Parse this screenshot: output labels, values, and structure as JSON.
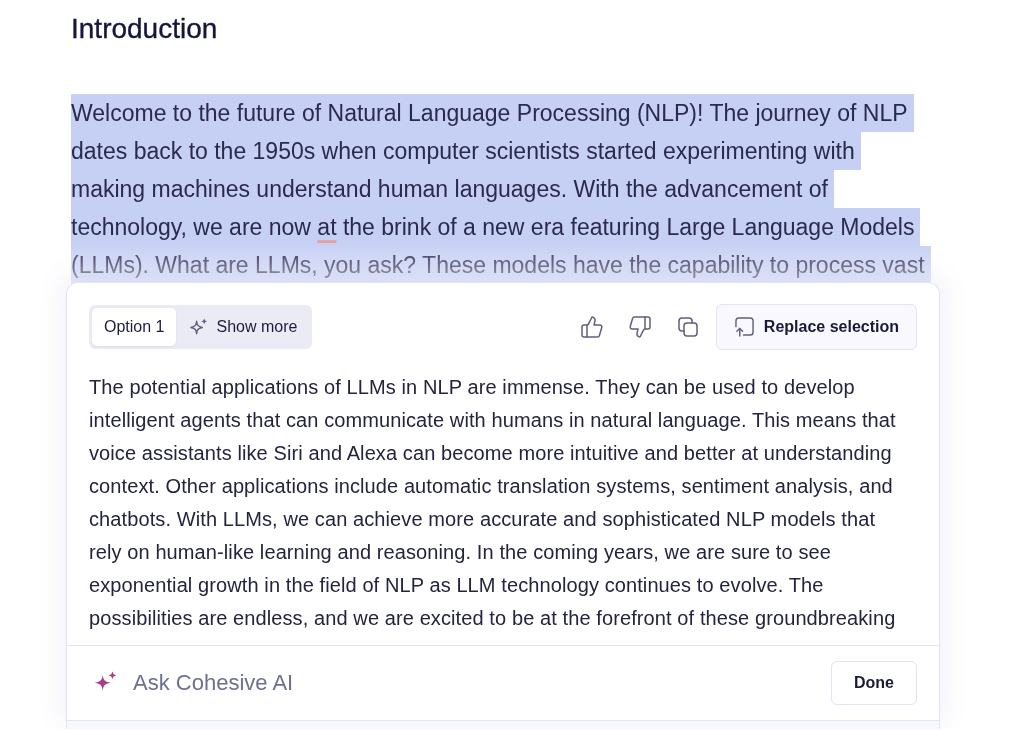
{
  "document": {
    "heading": "Introduction",
    "paragraph": {
      "selected": true,
      "lines": [
        [
          {
            "text": "Welcome to the future of Natural Language Processing (NLP)! The journey of NLP",
            "misspelled": false
          }
        ],
        [
          {
            "text": "dates back to the 1950s when computer scientists started experimenting with",
            "misspelled": false
          }
        ],
        [
          {
            "text": "making machines understand human languages. With the advancement of",
            "misspelled": false
          }
        ],
        [
          {
            "text": "technology, we are now ",
            "misspelled": false
          },
          {
            "text": "at",
            "misspelled": true
          },
          {
            "text": " the brink of a new era featuring Large Language Models",
            "misspelled": false
          }
        ],
        [
          {
            "text": "(LLMs). What are LLMs, you ask? These models have the capability to process vast",
            "misspelled": false
          }
        ]
      ]
    }
  },
  "suggestion_panel": {
    "options": [
      {
        "label": "Option 1",
        "selected": true
      }
    ],
    "show_more": "Show more",
    "replace_button": "Replace selection",
    "text_lines": [
      "The potential applications of LLMs in NLP are immense. They can be used to develop",
      "intelligent agents that can communicate with humans in natural language. This means that",
      "voice assistants like Siri and Alexa can become more intuitive and better at understanding",
      "context. Other applications include automatic translation systems, sentiment analysis, and",
      "chatbots. With LLMs, we can achieve more accurate and sophisticated NLP models that",
      "rely on human-like learning and reasoning. In the coming years, we are sure to see",
      "exponential growth in the field of NLP as LLM technology continues to evolve. The",
      "possibilities are endless, and we are excited to be at the forefront of these groundbreaking"
    ],
    "ask_field": {
      "placeholder": "Ask Cohesive AI"
    },
    "done_button": "Done"
  }
}
